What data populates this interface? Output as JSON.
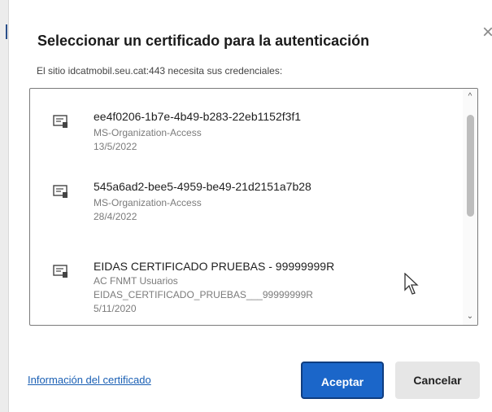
{
  "dialog": {
    "title": "Seleccionar un certificado para la autenticación",
    "subtitle": "El sitio idcatmobil.seu.cat:443 necesita sus credenciales:",
    "close_glyph": "×"
  },
  "certificates": [
    {
      "name": "ee4f0206-1b7e-4b49-b283-22eb1152f3f1",
      "line1": "MS-Organization-Access",
      "line2": "13/5/2022",
      "line3": ""
    },
    {
      "name": "545a6ad2-bee5-4959-be49-21d2151a7b28",
      "line1": "MS-Organization-Access",
      "line2": "28/4/2022",
      "line3": ""
    },
    {
      "name": "EIDAS CERTIFICADO PRUEBAS - 99999999R",
      "line1": "AC FNMT Usuarios",
      "line2": "EIDAS_CERTIFICADO_PRUEBAS___99999999R",
      "line3": "5/11/2020"
    }
  ],
  "scrollbar": {
    "up_glyph": "^",
    "down_glyph": "⌄"
  },
  "footer": {
    "info_link": "Información del certificado",
    "accept_label": "Aceptar",
    "cancel_label": "Cancelar"
  },
  "colors": {
    "accent": "#1b66c9",
    "link": "#1a5fb4",
    "icon": "certificate-icon"
  }
}
